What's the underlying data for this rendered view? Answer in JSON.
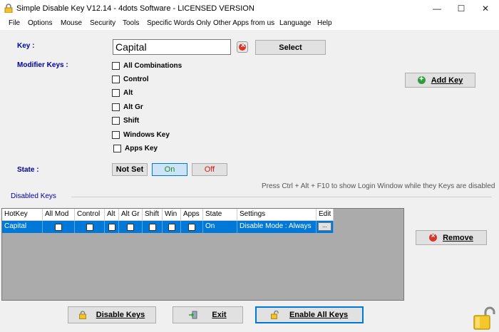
{
  "window": {
    "title": "Simple Disable Key V12.14 - 4dots Software - LICENSED VERSION",
    "minimize": "—",
    "maximize": "☐",
    "close": "✕"
  },
  "menu": [
    "File",
    "Options",
    "Mouse",
    "Security",
    "Tools",
    "Specific Words Only",
    "Other Apps from us",
    "Language",
    "Help"
  ],
  "key_section": {
    "label": "Key :",
    "value": "Capital",
    "select_label": "Select"
  },
  "modifiers": {
    "label": "Modifier Keys :",
    "options": [
      {
        "label": "All Combinations",
        "checked": false
      },
      {
        "label": "Control",
        "checked": false
      },
      {
        "label": "Alt",
        "checked": false
      },
      {
        "label": "Alt Gr",
        "checked": false
      },
      {
        "label": "Shift",
        "checked": false
      },
      {
        "label": "Windows Key",
        "checked": false
      },
      {
        "label": "Apps Key",
        "checked": false
      }
    ]
  },
  "add_key_label": "Add Key",
  "state": {
    "label": "State :",
    "not_set": "Not Set",
    "on": "On",
    "off": "Off",
    "selected": "On"
  },
  "hint": "Press Ctrl + Alt + F10 to show Login Window while they Keys are disabled",
  "disabled_keys": {
    "title": "Disabled Keys",
    "columns": [
      "HotKey",
      "All Mod",
      "Control",
      "Alt",
      "Alt Gr",
      "Shift",
      "Win",
      "Apps",
      "State",
      "Settings",
      "Edit"
    ],
    "rows": [
      {
        "hotkey": "Capital",
        "all_mod": false,
        "control": false,
        "alt": false,
        "alt_gr": false,
        "shift": false,
        "win": false,
        "apps": false,
        "state": "On",
        "settings": "Disable Mode : Always",
        "edit": "..."
      }
    ]
  },
  "remove_label": "Remove",
  "bottom": {
    "disable_keys": "Disable Keys",
    "exit": "Exit",
    "enable_all_keys": "Enable All Keys"
  },
  "colors": {
    "label_blue": "#00009c",
    "selection_blue": "#0078d7",
    "on_green": "#1f8a1f",
    "off_red": "#d81818"
  }
}
